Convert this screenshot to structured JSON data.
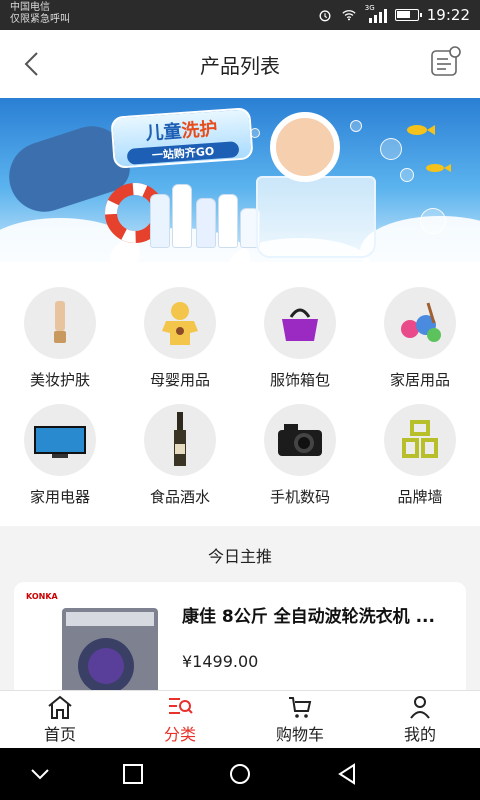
{
  "status_bar": {
    "carrier_line1": "中国电信",
    "carrier_line2": "仅限紧急呼叫",
    "signal_label": "3G",
    "time": "19:22"
  },
  "header": {
    "title": "产品列表",
    "back_icon": "chevron-left-icon",
    "message_icon": "message-list-icon"
  },
  "banner": {
    "title_black": "儿童",
    "title_red": "洗护",
    "subtitle": "一站购齐GO"
  },
  "categories": [
    {
      "label": "美妆护肤",
      "icon": "cosmetics-icon"
    },
    {
      "label": "母婴用品",
      "icon": "baby-clothes-icon"
    },
    {
      "label": "服饰箱包",
      "icon": "handbag-icon"
    },
    {
      "label": "家居用品",
      "icon": "household-icon"
    },
    {
      "label": "家用电器",
      "icon": "tv-icon"
    },
    {
      "label": "食品酒水",
      "icon": "wine-bottle-icon"
    },
    {
      "label": "手机数码",
      "icon": "camera-icon"
    },
    {
      "label": "品牌墙",
      "icon": "brand-wall-icon"
    }
  ],
  "today": {
    "title": "今日主推",
    "product": {
      "brand": "KONKA",
      "name": "康佳 8公斤 全自动波轮洗衣机 ...",
      "price": "¥1499.00"
    }
  },
  "tabbar": {
    "tabs": [
      {
        "label": "首页",
        "icon": "home-icon",
        "active": false
      },
      {
        "label": "分类",
        "icon": "category-list-icon",
        "active": true
      },
      {
        "label": "购物车",
        "icon": "cart-icon",
        "active": false
      },
      {
        "label": "我的",
        "icon": "user-icon",
        "active": false
      }
    ],
    "active_color": "#e8312a",
    "inactive_color": "#222222"
  }
}
